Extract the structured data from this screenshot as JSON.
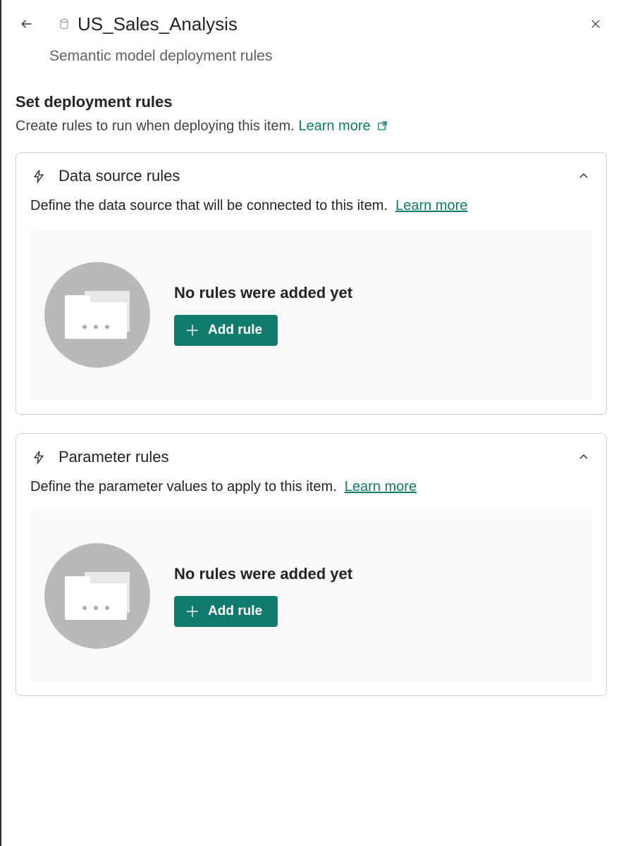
{
  "header": {
    "title": "US_Sales_Analysis",
    "subtitle": "Semantic model deployment rules"
  },
  "section": {
    "title": "Set deployment rules",
    "description": "Create rules to run when deploying this item.",
    "learn_more": "Learn more"
  },
  "cards": {
    "data_source": {
      "title": "Data source rules",
      "description": "Define the data source that will be connected to this item.",
      "learn_more": "Learn more",
      "empty_text": "No rules were added yet",
      "add_rule_label": "Add rule"
    },
    "parameter": {
      "title": "Parameter rules",
      "description": "Define the parameter values to apply to this item.",
      "learn_more": "Learn more",
      "empty_text": "No rules were added yet",
      "add_rule_label": "Add rule"
    }
  }
}
